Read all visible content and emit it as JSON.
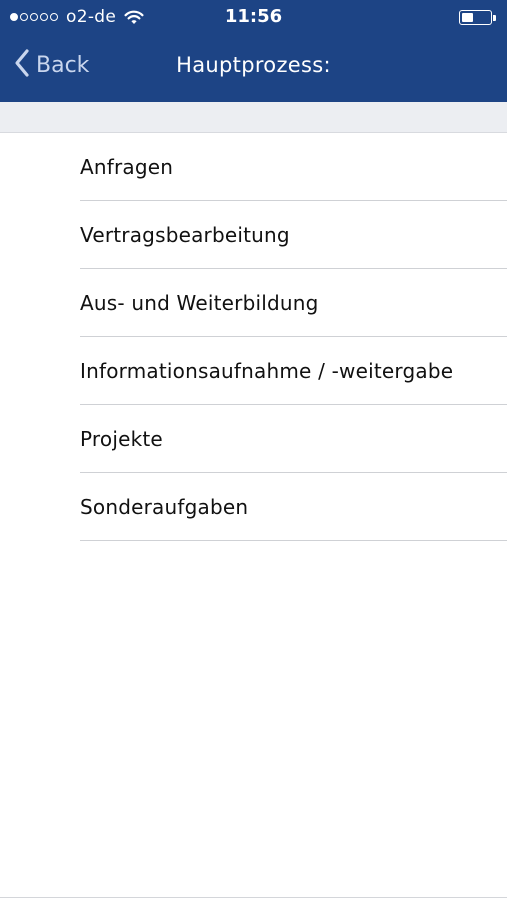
{
  "status_bar": {
    "carrier": "o2-de",
    "time": "11:56",
    "signal_dots_filled": 1,
    "signal_dots_total": 5,
    "battery_level": 0.4
  },
  "nav": {
    "back_label": "Back",
    "title": "Hauptprozess:"
  },
  "list": {
    "items": [
      {
        "label": "Anfragen"
      },
      {
        "label": "Vertragsbearbeitung"
      },
      {
        "label": "Aus- und Weiterbildung"
      },
      {
        "label": "Informationsaufnahme / -weitergabe"
      },
      {
        "label": "Projekte"
      },
      {
        "label": "Sonderaufgaben"
      }
    ]
  },
  "colors": {
    "nav_background": "#1d4485",
    "section_band": "#eceef2",
    "separator": "#cfd1d5"
  }
}
